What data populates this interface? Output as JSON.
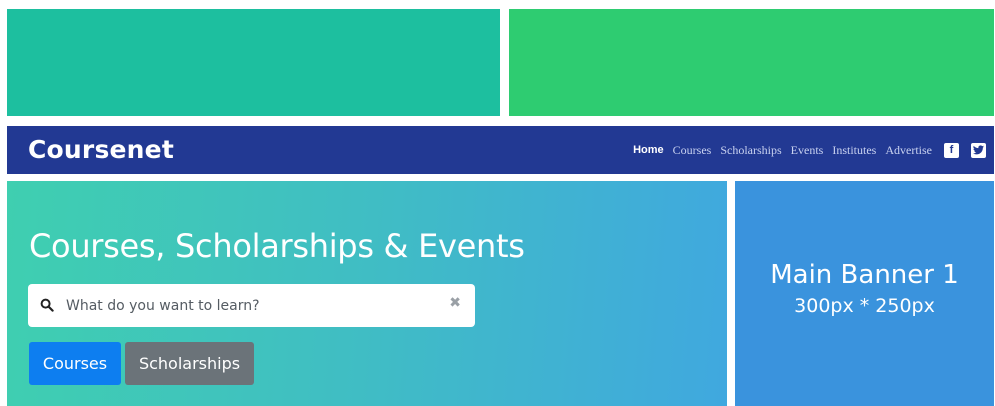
{
  "ads": {
    "top_left_color": "#1dbf9f",
    "top_right_color": "#2ecc71"
  },
  "navbar": {
    "brand": "Coursenet",
    "links": [
      "Home",
      "Courses",
      "Scholarships",
      "Events",
      "Institutes",
      "Advertise"
    ],
    "active_link": "Home",
    "social_icons": [
      "facebook-icon",
      "twitter-icon"
    ],
    "background": "#223993"
  },
  "hero": {
    "title": "Courses, Scholarships & Events",
    "search_placeholder": "What do you want to learn?",
    "search_value": "",
    "buttons": {
      "courses_label": "Courses",
      "scholarships_label": "Scholarships"
    },
    "colors": {
      "courses_button": "#0d7ef0",
      "scholarships_button": "#6b7379"
    }
  },
  "banner": {
    "title": "Main Banner 1",
    "subtitle": "300px * 250px",
    "background": "#3a93dd"
  }
}
